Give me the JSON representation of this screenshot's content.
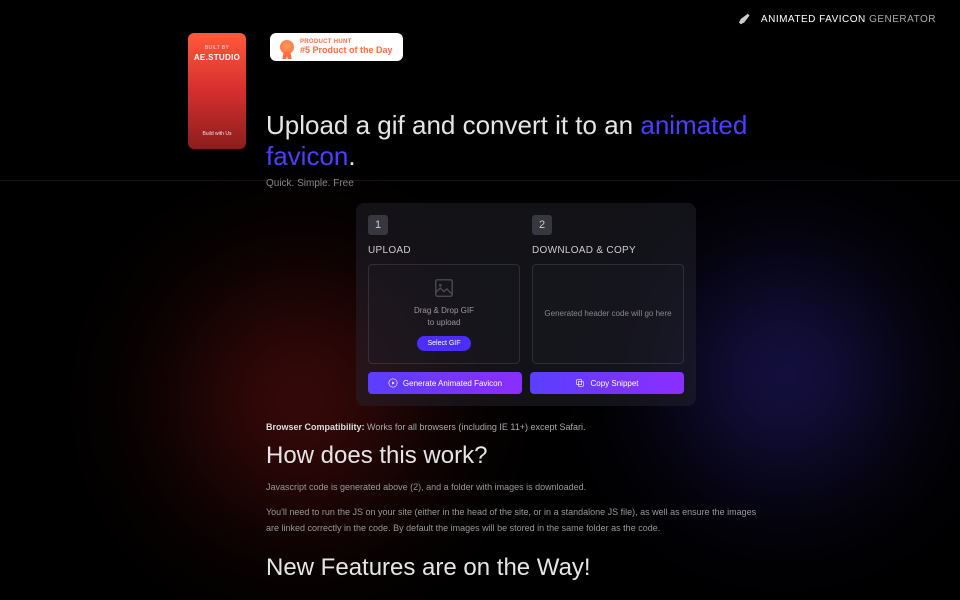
{
  "brand": {
    "name_bold": "ANIMATED FAVICON",
    "name_thin": "GENERATOR"
  },
  "sidecard": {
    "built_by": "BUILT BY",
    "studio": "AE.STUDIO",
    "cta": "Build with Us"
  },
  "badge": {
    "source": "PRODUCT HUNT",
    "rank": "#5 Product of the Day"
  },
  "headline": {
    "prefix": "Upload a gif and convert it to an ",
    "accent": "animated favicon",
    "suffix": "."
  },
  "tagline": "Quick. Simple. Free",
  "panel": {
    "step1": {
      "num": "1",
      "label": "UPLOAD",
      "drop_line1": "Drag & Drop GIF",
      "drop_line2": "to upload",
      "select": "Select GIF"
    },
    "step2": {
      "num": "2",
      "label": "DOWNLOAD & COPY",
      "placeholder": "Generated header code will go here"
    },
    "generate": "Generate Animated Favicon",
    "copy": "Copy Snippet"
  },
  "compat": {
    "label": "Browser Compatibility:",
    "text": " Works for all browsers (including IE 11+) except Safari."
  },
  "how_heading": "How does this work?",
  "how_p1": "Javascript code is generated above (2), and a folder with images is downloaded.",
  "how_p2": "You'll need to run the JS on your site (either in the head of the site, or in a standalone JS file), as well as ensure the images are linked correctly in the code. By default the images will be stored in the same folder as the code.",
  "new_heading": "New Features are on the Way!"
}
